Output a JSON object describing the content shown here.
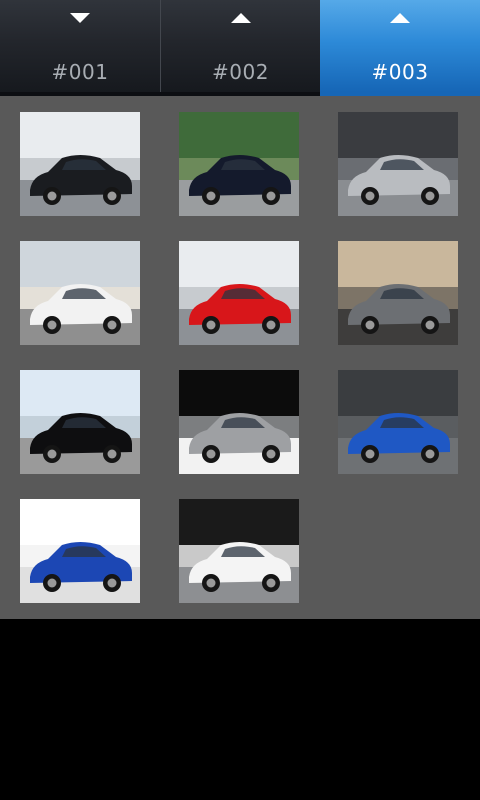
{
  "tabs": [
    {
      "label": "#001",
      "icon": "arrow-down-icon",
      "active": false
    },
    {
      "label": "#002",
      "icon": "arrow-up-icon",
      "active": false
    },
    {
      "label": "#003",
      "icon": "arrow-up-icon",
      "active": true
    }
  ],
  "colors": {
    "accent": "#1f78c8",
    "grid_background": "#595959",
    "page_background": "#000000"
  },
  "gallery": {
    "items": [
      {
        "name": "black-sedan-photo",
        "car_color": "#1a1c20",
        "scene": "road"
      },
      {
        "name": "black-coupe-photo",
        "car_color": "#141a2c",
        "scene": "trees"
      },
      {
        "name": "silver-coupe-photo",
        "car_color": "#b9bcc0",
        "scene": "studio"
      },
      {
        "name": "white-sedan-photo",
        "car_color": "#f2f2f2",
        "scene": "house"
      },
      {
        "name": "red-sports-car-photo",
        "car_color": "#d8161a",
        "scene": "road"
      },
      {
        "name": "grey-sports-car-photo",
        "car_color": "#6c6f73",
        "scene": "dusk"
      },
      {
        "name": "black-beetle-photo",
        "car_color": "#0e0e10",
        "scene": "sky"
      },
      {
        "name": "silver-supercar-photo",
        "car_color": "#9ea0a3",
        "scene": "dark"
      },
      {
        "name": "blue-coupe-photo",
        "car_color": "#1f58c4",
        "scene": "garage"
      },
      {
        "name": "blue-rally-car-photo",
        "car_color": "#1c47b4",
        "scene": "white"
      },
      {
        "name": "white-race-car-photo",
        "car_color": "#f4f4f4",
        "scene": "track"
      }
    ]
  }
}
